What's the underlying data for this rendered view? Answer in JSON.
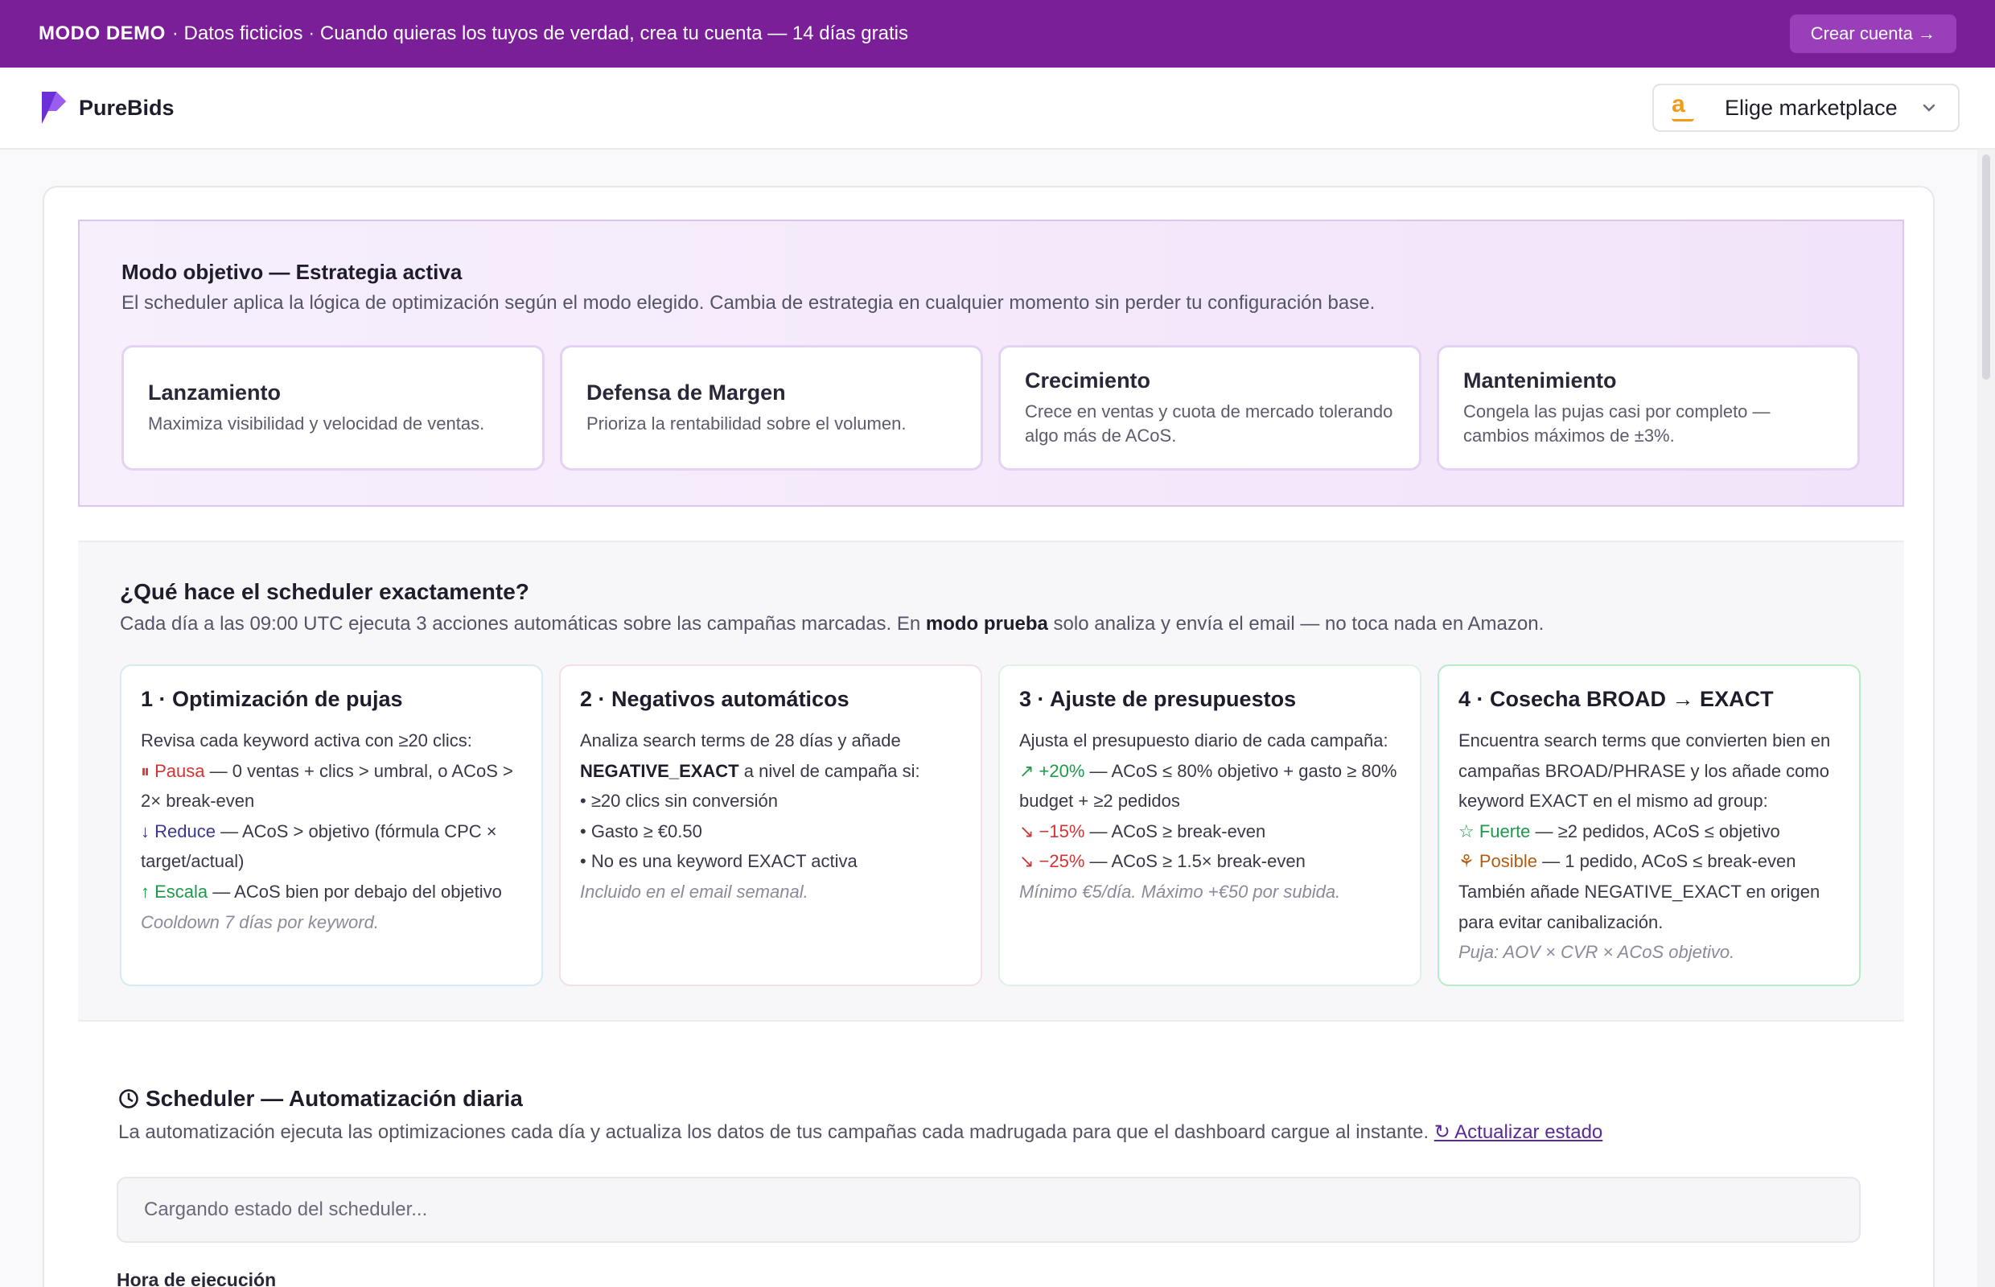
{
  "banner": {
    "mode": "MODO DEMO",
    "message": "· Datos ficticios · Cuando quieras los tuyos de verdad, crea tu cuenta — 14 días gratis",
    "cta": "Crear cuenta →"
  },
  "header": {
    "brand": "PureBids",
    "marketplace_label": "Elige marketplace",
    "marketplace_icon": "amazon-icon"
  },
  "strategy": {
    "title": "Modo objetivo — Estrategia activa",
    "subtitle": "El scheduler aplica la lógica de optimización según el modo elegido. Cambia de estrategia en cualquier momento sin perder tu configuración base.",
    "modes": [
      {
        "name": "Lanzamiento",
        "description": "Maximiza visibilidad y velocidad de ventas."
      },
      {
        "name": "Defensa de Margen",
        "description": "Prioriza la rentabilidad sobre el volumen."
      },
      {
        "name": "Crecimiento",
        "description": "Crece en ventas y cuota de mercado tolerando algo más de ACoS."
      },
      {
        "name": "Mantenimiento",
        "description": "Congela las pujas casi por completo — cambios máximos de ±3%."
      }
    ]
  },
  "how": {
    "title": "¿Qué hace el scheduler exactamente?",
    "subtitle_a": "Cada día a las 09:00 UTC ejecuta 3 acciones automáticas sobre las campañas marcadas. En ",
    "subtitle_bold": "modo prueba",
    "subtitle_b": " solo analiza y envía el email — no toca nada en Amazon.",
    "actions": [
      {
        "title": "1 · Optimización de pujas",
        "intro": "Revisa cada keyword activa con ≥20 clics:",
        "pause_label": "⏸ Pausa",
        "pause_text": " — 0 ventas + clics > umbral, o ACoS > 2× break-even",
        "reduce_label": "↓ Reduce",
        "reduce_text": " — ACoS > objetivo (fórmula CPC × target/actual)",
        "scale_label": "↑ Escala",
        "scale_text": " — ACoS bien por debajo del objetivo",
        "note": "Cooldown 7 días por keyword."
      },
      {
        "title": "2 · Negativos automáticos",
        "intro_a": "Analiza search terms de 28 días y añade ",
        "intro_bold": "NEGATIVE_EXACT",
        "intro_b": " a nivel de campaña si:",
        "bullets": [
          "• ≥20 clics sin conversión",
          "• Gasto ≥ €0.50",
          "• No es una keyword EXACT activa"
        ],
        "note": "Incluido en el email semanal."
      },
      {
        "title": "3 · Ajuste de presupuestos",
        "intro": "Ajusta el presupuesto diario de cada campaña:",
        "up_label": "↗ +20%",
        "up_text": " — ACoS ≤ 80% objetivo + gasto ≥ 80% budget + ≥2 pedidos",
        "down1_label": "↘ −15%",
        "down1_text": " — ACoS ≥ break-even",
        "down2_label": "↘ −25%",
        "down2_text": " — ACoS ≥ 1.5× break-even",
        "note": "Mínimo €5/día. Máximo +€50 por subida."
      },
      {
        "title": "4 · Cosecha BROAD → EXACT",
        "intro": "Encuentra search terms que convierten bien en campañas BROAD/PHRASE y los añade como keyword EXACT en el mismo ad group:",
        "strong_label": "☆ Fuerte",
        "strong_text": " — ≥2 pedidos, ACoS ≤ objetivo",
        "possible_label": "Posible",
        "possible_text": " — 1 pedido, ACoS ≤ break-even",
        "outro": "También añade NEGATIVE_EXACT en origen para evitar canibalización.",
        "note": "Puja: AOV × CVR × ACoS objetivo."
      }
    ]
  },
  "scheduler": {
    "title": "Scheduler — Automatización diaria",
    "subtitle": "La automatización ejecuta las optimizaciones cada día y actualiza los datos de tus campañas cada madrugada para que el dashboard cargue al instante.",
    "refresh_link": "↻ Actualizar estado",
    "loading": "Cargando estado del scheduler...",
    "hour_label": "Hora de ejecución"
  },
  "colors": {
    "banner": "#7a1f98",
    "accent": "#7a3fe0",
    "pause": "#d23434",
    "reduce": "#3b3794",
    "scale": "#1e9a4a",
    "possible": "#b35c10"
  }
}
